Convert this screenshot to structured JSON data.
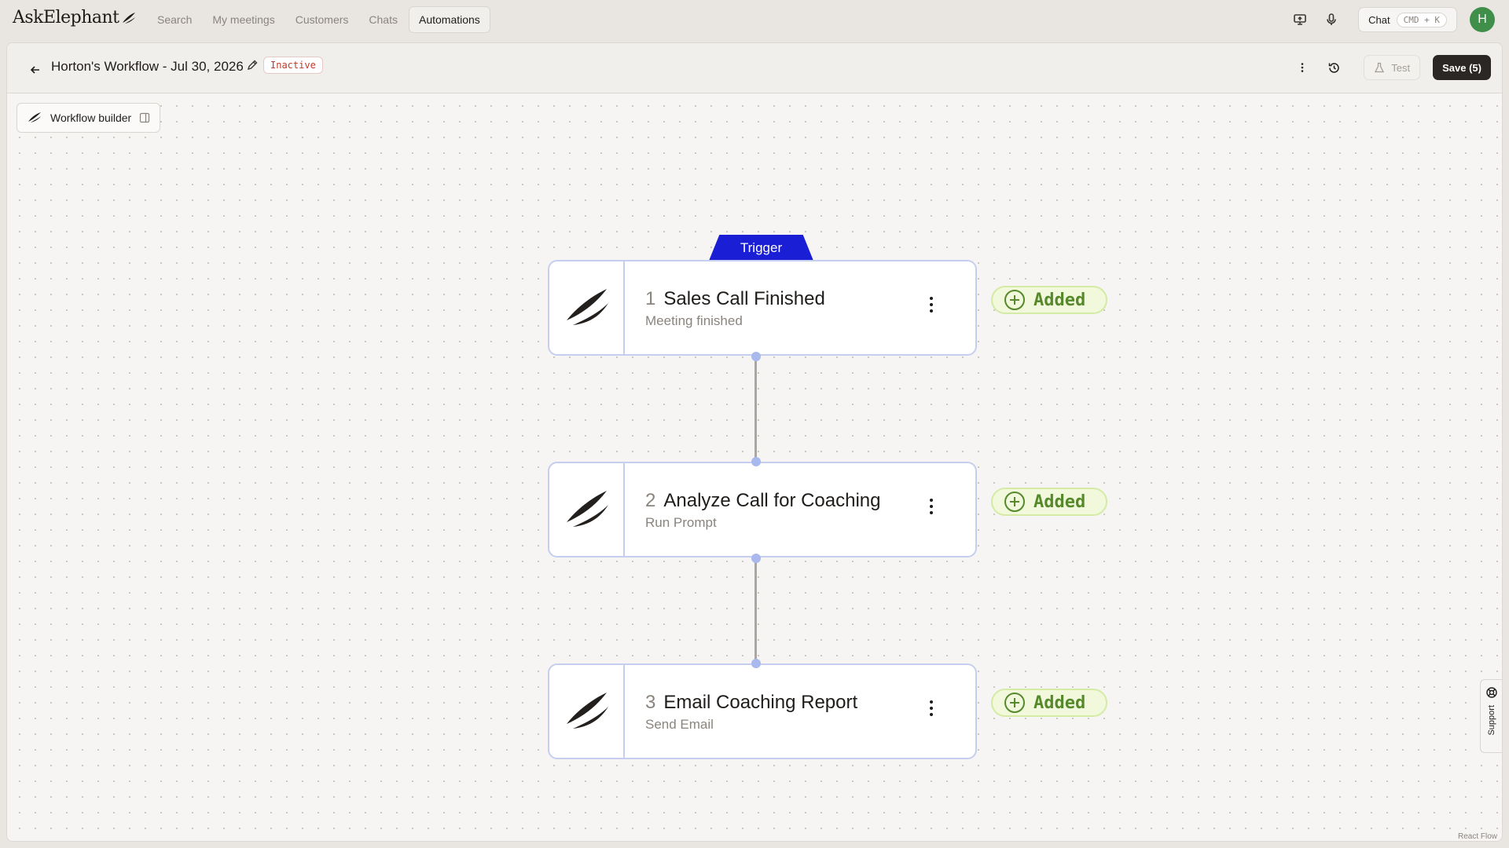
{
  "app": {
    "logo_text": "AskElephant"
  },
  "nav": {
    "items": [
      {
        "label": "Search"
      },
      {
        "label": "My meetings"
      },
      {
        "label": "Customers"
      },
      {
        "label": "Chats"
      },
      {
        "label": "Automations",
        "active": true
      }
    ]
  },
  "top_right": {
    "chat_label": "Chat",
    "chat_shortcut": "CMD + K",
    "avatar_initial": "H",
    "avatar_color": "#3f8f4a"
  },
  "workflow": {
    "title": "Horton's Workflow - Jul 30, 2026",
    "status": "Inactive",
    "test_label": "Test",
    "save_label": "Save (5)"
  },
  "canvas": {
    "builder_label": "Workflow builder",
    "trigger_label": "Trigger",
    "nodes": [
      {
        "number": "1",
        "title": "Sales Call Finished",
        "subtitle": "Meeting finished",
        "badge": "Added"
      },
      {
        "number": "2",
        "title": "Analyze Call for Coaching",
        "subtitle": "Run Prompt",
        "badge": "Added"
      },
      {
        "number": "3",
        "title": "Email Coaching Report",
        "subtitle": "Send Email",
        "badge": "Added"
      }
    ],
    "toolbar": [
      "copy-icon",
      "paste-icon",
      "undo-icon",
      "redo-icon",
      "layout-grid-icon"
    ],
    "support_label": "Support",
    "attribution": "React Flow"
  },
  "colors": {
    "trigger": "#1a1fd6",
    "node_border": "#c5ceee",
    "added_text": "#56892b",
    "inactive": "#c0392b"
  }
}
